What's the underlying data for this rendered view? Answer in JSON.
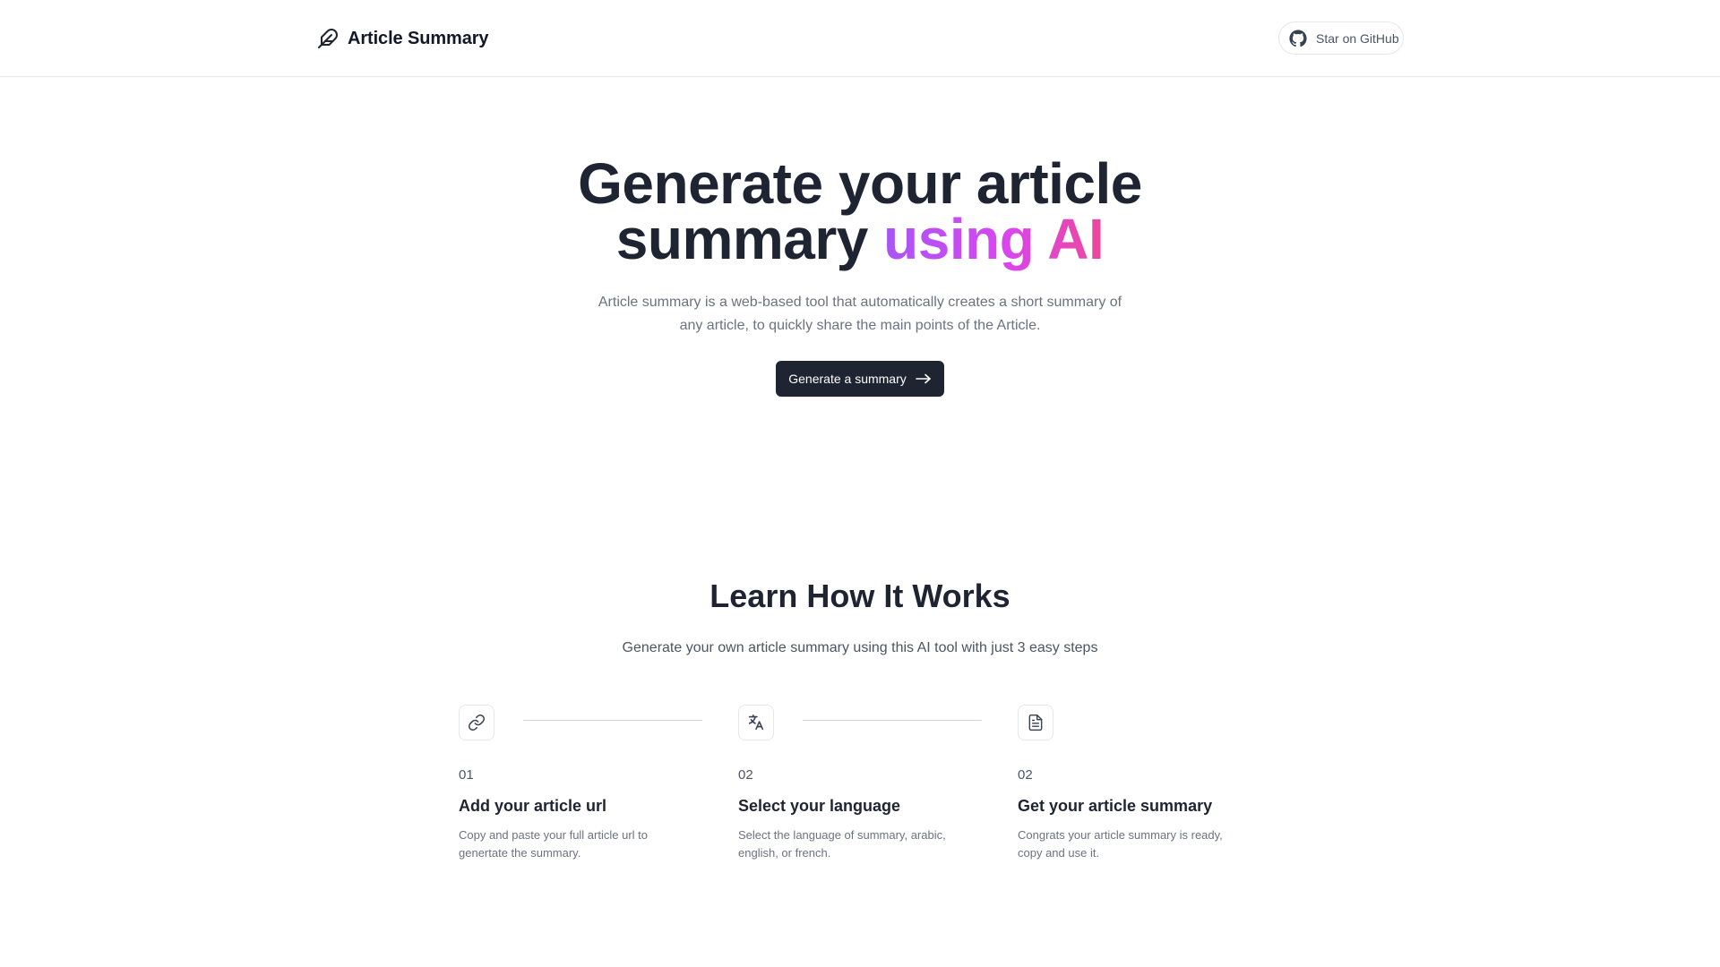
{
  "header": {
    "brand": "Article Summary",
    "brand_icon": "feather-icon",
    "github_label": "Star on GitHub",
    "github_icon": "github-icon"
  },
  "hero": {
    "title_line1": "Generate your article",
    "title_line2_plain": "summary",
    "title_line2_highlight": "using AI",
    "subtitle": "Article summary is a web-based tool that automatically creates a short summary of any article, to quickly share the main points of the Article.",
    "cta_label": "Generate a summary",
    "cta_icon": "arrow-right-icon"
  },
  "how": {
    "title": "Learn How It Works",
    "subtitle": "Generate your own article summary using this AI tool with just 3 easy steps",
    "steps": [
      {
        "icon": "link-icon",
        "number": "01",
        "title": "Add your article url",
        "desc": "Copy and paste your full article url to genertate the summary."
      },
      {
        "icon": "translate-icon",
        "number": "02",
        "title": "Select your language",
        "desc": "Select the language of summary, arabic, english, or french."
      },
      {
        "icon": "document-icon",
        "number": "02",
        "title": "Get your article summary",
        "desc": "Congrats your article summary is ready, copy and use it."
      }
    ]
  },
  "colors": {
    "primary_dark": "#1f2433",
    "gradient_start": "#a855f7",
    "gradient_end": "#ec4899",
    "border": "#e5e7eb",
    "muted_text": "#6b7280"
  }
}
